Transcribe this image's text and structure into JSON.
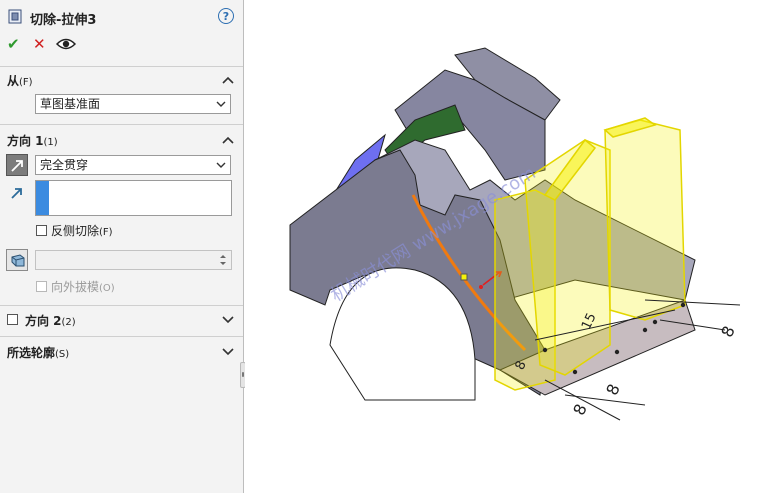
{
  "panel": {
    "title": "切除-拉伸3",
    "help_label": "?",
    "ok_glyph": "✔",
    "cancel_glyph": "✕",
    "from": {
      "label": "从",
      "key": "(F)",
      "value": "草图基准面"
    },
    "direction1": {
      "label": "方向 1",
      "key": "(1)",
      "end_condition": "完全贯穿",
      "flip_side": {
        "label": "反侧切除",
        "key": "(F)",
        "checked": false
      },
      "draft_outward": {
        "label": "向外拔模",
        "key": "(O)",
        "checked": false
      }
    },
    "direction2": {
      "label": "方向 2",
      "key": "(2)",
      "checked": false
    },
    "selected_contours": {
      "label": "所选轮廓",
      "key": "(S)"
    }
  },
  "viewport": {
    "watermark": "机械时代网 www.jxage.com",
    "dims": [
      "8",
      "8",
      "8",
      "15",
      "8"
    ]
  },
  "colors": {
    "accent": "#3b8be0",
    "ok": "#2f9a2f",
    "cancel": "#d02020",
    "extrude": "#f5f10a"
  }
}
